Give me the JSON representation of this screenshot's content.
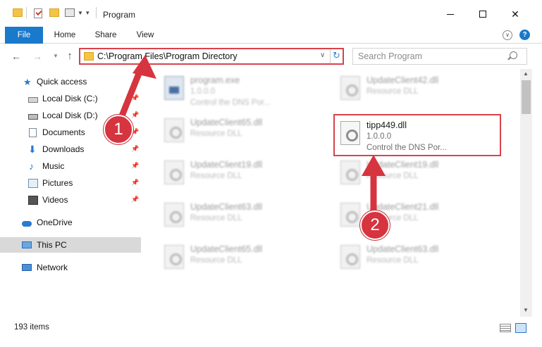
{
  "window": {
    "title": "Program",
    "minimize_label": "—",
    "close_label": "✕"
  },
  "ribbon": {
    "tabs": [
      "File",
      "Home",
      "Share",
      "View"
    ],
    "help_label": "?"
  },
  "address_bar": {
    "path": "C:\\Program Files\\Program Directory",
    "search_placeholder": "Search Program"
  },
  "sidebar": {
    "items": [
      {
        "label": "Quick access",
        "icon": "star-icon",
        "pinned": false
      },
      {
        "label": "Local Disk (C:)",
        "icon": "disk-icon",
        "pinned": true
      },
      {
        "label": "Local Disk (D:)",
        "icon": "disk-icon",
        "pinned": true
      },
      {
        "label": "Documents",
        "icon": "documents-icon",
        "pinned": true
      },
      {
        "label": "Downloads",
        "icon": "download-icon",
        "pinned": true
      },
      {
        "label": "Music",
        "icon": "music-icon",
        "pinned": true
      },
      {
        "label": "Pictures",
        "icon": "pictures-icon",
        "pinned": true
      },
      {
        "label": "Videos",
        "icon": "videos-icon",
        "pinned": true
      },
      {
        "label": "OneDrive",
        "icon": "cloud-icon",
        "pinned": false
      },
      {
        "label": "This PC",
        "icon": "computer-icon",
        "pinned": false,
        "selected": true
      },
      {
        "label": "Network",
        "icon": "network-icon",
        "pinned": false
      }
    ]
  },
  "files": [
    {
      "name": "program.exe",
      "line1": "1.0.0.0",
      "line2": "Control the DNS Por..."
    },
    {
      "name": "UpdateClient42.dll",
      "line1": "Resource DLL",
      "line2": ""
    },
    {
      "name": "UpdateClient65.dll",
      "line1": "Resource DLL",
      "line2": ""
    },
    {
      "name": "tipp449.dll",
      "line1": "1.0.0.0",
      "line2": "Control the DNS Por..."
    },
    {
      "name": "UpdateClient19.dll",
      "line1": "Resource DLL",
      "line2": ""
    },
    {
      "name": "UpdateClient19.dll",
      "line1": "Resource DLL",
      "line2": ""
    },
    {
      "name": "UpdateClient63.dll",
      "line1": "Resource DLL",
      "line2": ""
    },
    {
      "name": "UpdateClient21.dll",
      "line1": "Resource DLL",
      "line2": ""
    },
    {
      "name": "UpdateClient65.dll",
      "line1": "Resource DLL",
      "line2": ""
    },
    {
      "name": "UpdateClient63.dll",
      "line1": "Resource DLL",
      "line2": ""
    }
  ],
  "status": {
    "item_count": "193 items"
  },
  "annotations": {
    "step1": "1",
    "step2": "2",
    "highlight_color": "#d9424a"
  },
  "colors": {
    "accent": "#1979ca",
    "annotation_red": "#d6343f"
  }
}
